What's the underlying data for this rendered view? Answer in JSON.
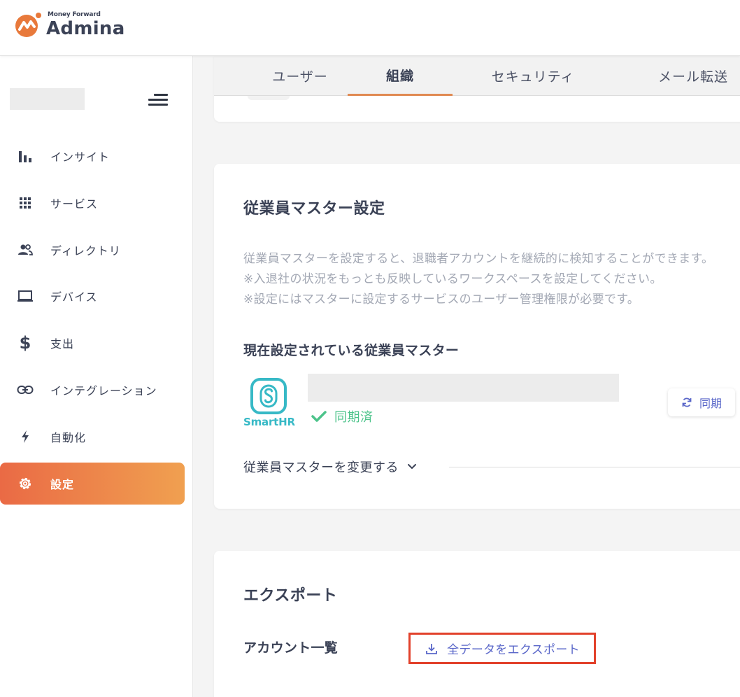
{
  "header": {
    "logo_small": "Money Forward",
    "logo_big": "Admina"
  },
  "sidebar": {
    "items": [
      {
        "label": "インサイト",
        "icon": "bar-chart-icon"
      },
      {
        "label": "サービス",
        "icon": "grid-icon"
      },
      {
        "label": "ディレクトリ",
        "icon": "people-icon"
      },
      {
        "label": "デバイス",
        "icon": "laptop-icon"
      },
      {
        "label": "支出",
        "icon": "dollar-icon"
      },
      {
        "label": "インテグレーション",
        "icon": "link-icon"
      },
      {
        "label": "自動化",
        "icon": "bolt-icon"
      },
      {
        "label": "設定",
        "icon": "gear-icon",
        "active": true
      }
    ]
  },
  "tabs": [
    {
      "label": "ユーザー"
    },
    {
      "label": "組織",
      "active": true
    },
    {
      "label": "セキュリティ"
    },
    {
      "label": "メール転送"
    }
  ],
  "master": {
    "title": "従業員マスター設定",
    "desc_line1": "従業員マスターを設定すると、退職者アカウントを継続的に検知することができます。",
    "desc_line2": "※入退社の状況をもっとも反映しているワークスペースを設定してください。",
    "desc_line3": "※設定にはマスターに設定するサービスのユーザー管理権限が必要です。",
    "current_title": "現在設定されている従業員マスター",
    "service_logo": "SmartHR",
    "sync_status": "同期済",
    "sync_button": "同期",
    "change_label": "従業員マスターを変更する"
  },
  "export": {
    "title": "エクスポート",
    "row_label": "アカウント一覧",
    "button_label": "全データをエクスポート"
  },
  "colors": {
    "brand_orange": "#ea6a45",
    "accent_blue": "#5a67c9",
    "success_green": "#4cc38a",
    "smarthr_teal": "#37b9c6",
    "highlight_red": "#e2412b"
  }
}
